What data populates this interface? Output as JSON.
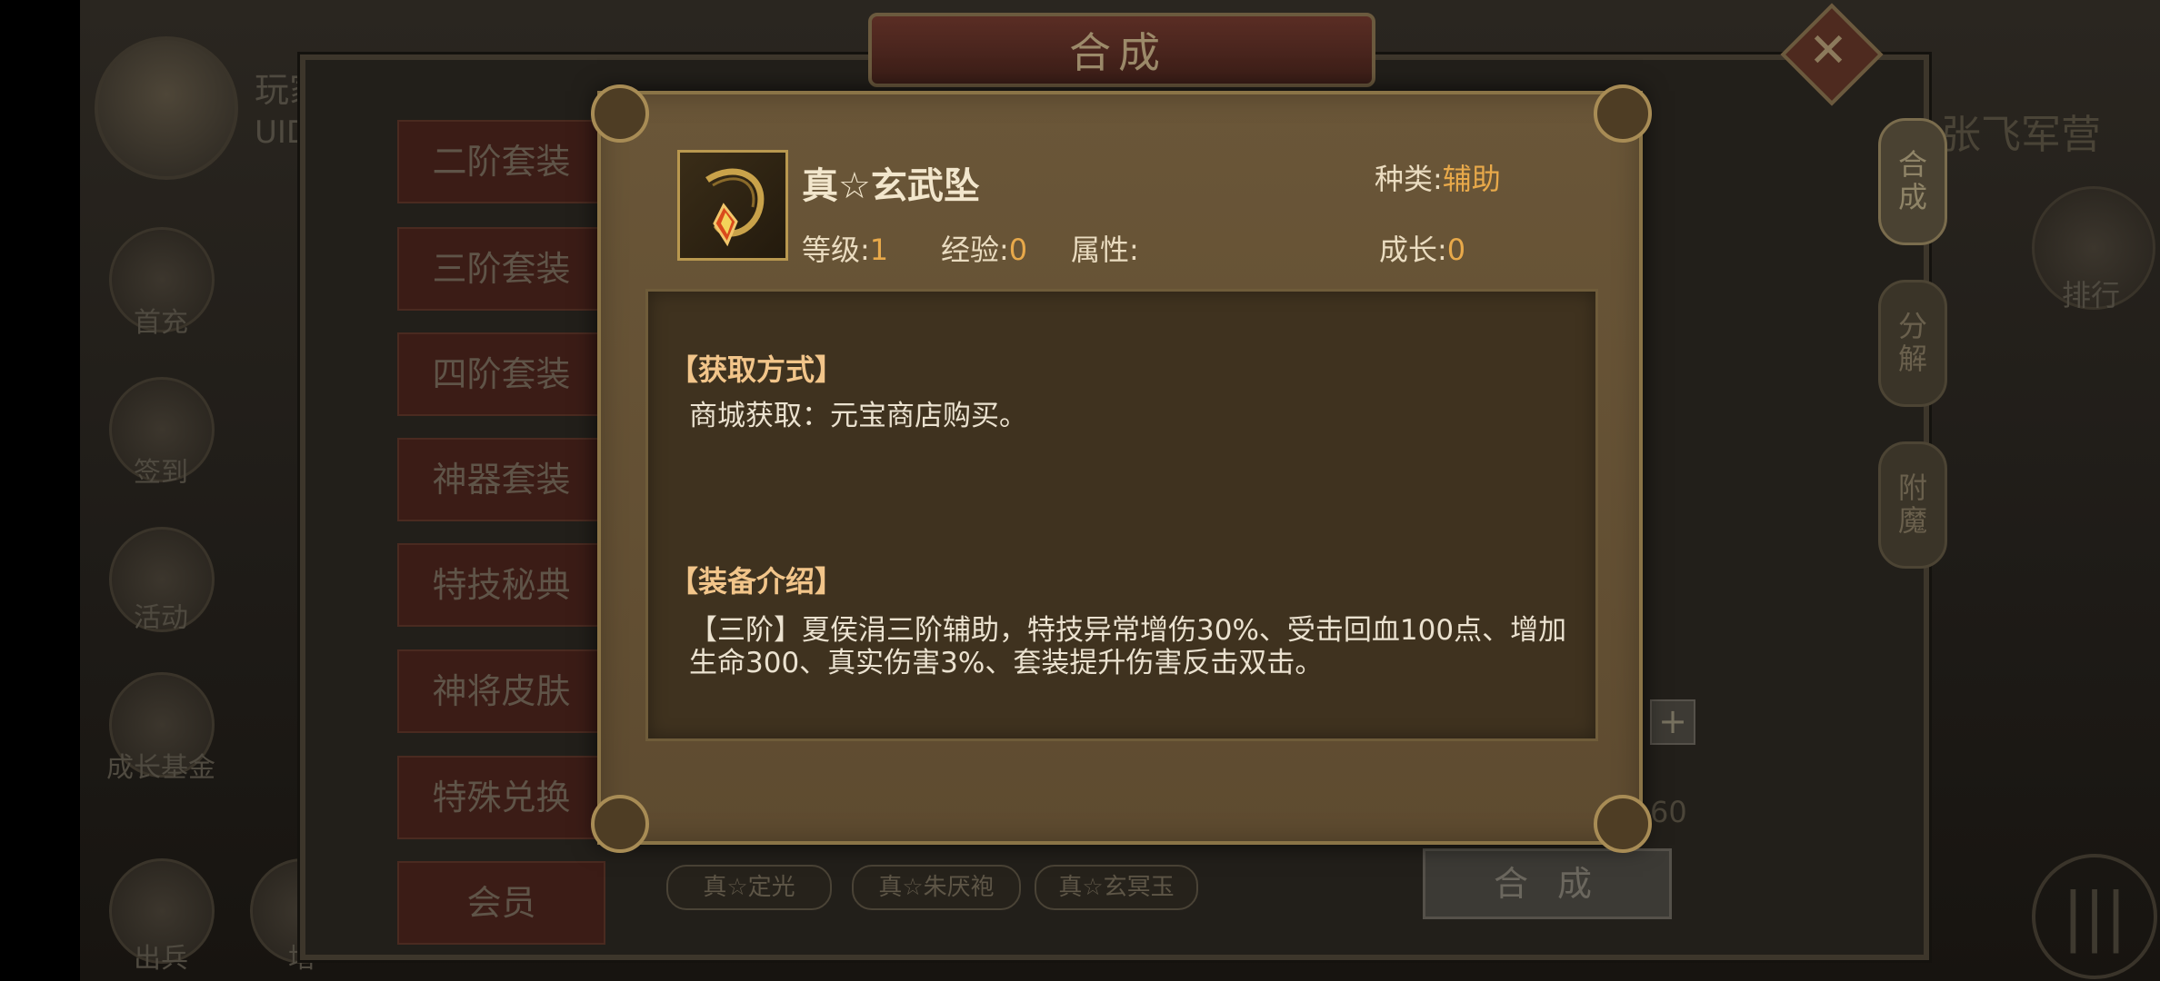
{
  "window": {
    "title": "合成",
    "close_icon": "✕"
  },
  "player": {
    "name": "玩家",
    "uid_label": "UID"
  },
  "left_menu": [
    {
      "label": "首充",
      "icon": "gift-icon"
    },
    {
      "label": "签到",
      "icon": "calendar-icon"
    },
    {
      "label": "活动",
      "icon": "event-icon"
    },
    {
      "label": "成长基金",
      "icon": "fund-icon"
    },
    {
      "label": "出兵",
      "icon": "troops-icon"
    },
    {
      "label": "培",
      "icon": "train-icon"
    }
  ],
  "categories": [
    "二阶套装",
    "三阶套装",
    "四阶套装",
    "神器套装",
    "特技秘典",
    "神将皮肤",
    "特殊兑换",
    "会员"
  ],
  "right_tabs": [
    "合成",
    "分解",
    "附魔"
  ],
  "camp_title": "张飞军营",
  "rank_label": "排行",
  "background_items": [
    "真☆定光",
    "真☆朱厌袍",
    "真☆玄冥玉"
  ],
  "combine_button": "合 成",
  "plus_label": "+",
  "count_text": "60",
  "menu_icon_glyph": "|||",
  "item": {
    "name": "真☆玄武坠",
    "type_label": "种类:",
    "type_value": "辅助",
    "level_label": "等级:",
    "level_value": "1",
    "exp_label": "经验:",
    "exp_value": "0",
    "attr_label": "属性:",
    "attr_value": "",
    "growth_label": "成长:",
    "growth_value": "0"
  },
  "obtain": {
    "heading": "【获取方式】",
    "text": "商城获取：元宝商店购买。"
  },
  "intro": {
    "heading": "【装备介绍】",
    "text": "【三阶】夏侯涓三阶辅助，特技异常增伤30%、受击回血100点、增加生命300、真实伤害3%、套装提升伤害反击双击。"
  },
  "colors": {
    "accent": "#e8a94a",
    "heading": "#f2c58a",
    "panel": "#5e4b30"
  }
}
